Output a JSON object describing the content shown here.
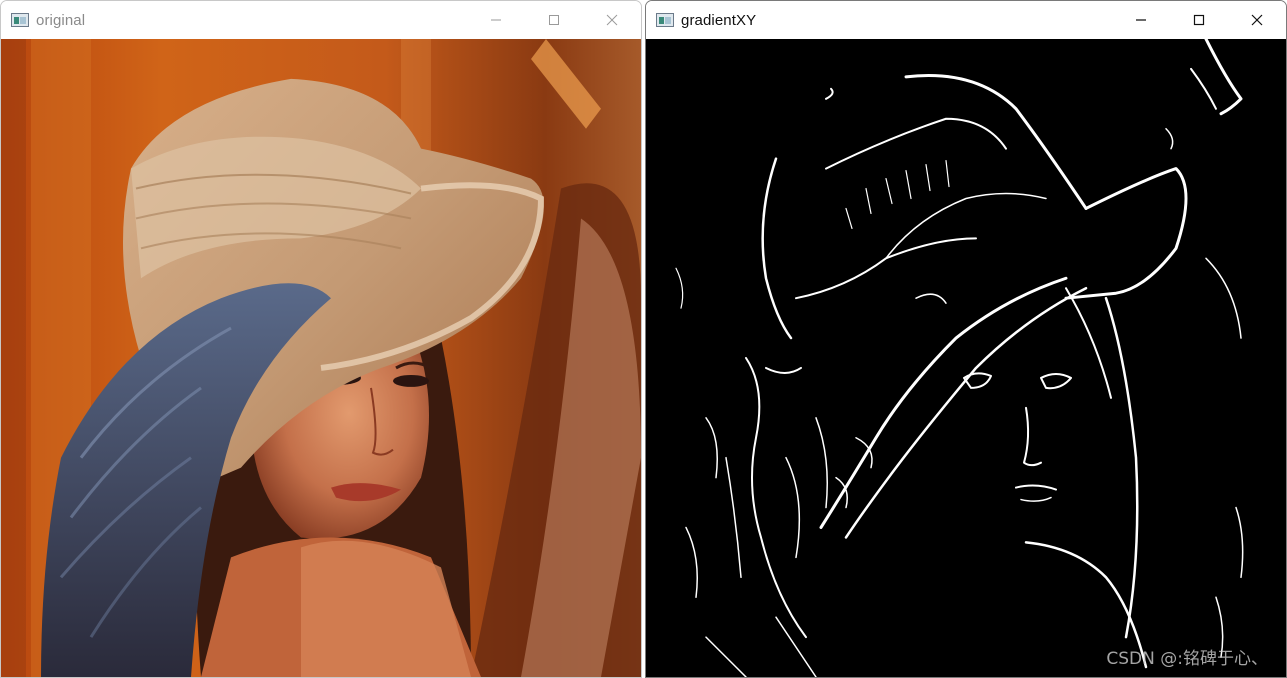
{
  "windows": {
    "original": {
      "title": "original",
      "icon": "opencv-window-icon",
      "controls": [
        "minimize",
        "maximize",
        "close"
      ],
      "active": false
    },
    "gradient": {
      "title": "gradientXY",
      "icon": "opencv-window-icon",
      "controls": [
        "minimize",
        "maximize",
        "close"
      ],
      "active": true
    }
  },
  "watermark": "CSDN @:铭碑于心、",
  "colors": {
    "titlebar": "#ffffff",
    "edge_background": "#000000",
    "edge_lines": "#ffffff",
    "photo_background": "#c4571a",
    "hat": "#c9a07a"
  }
}
